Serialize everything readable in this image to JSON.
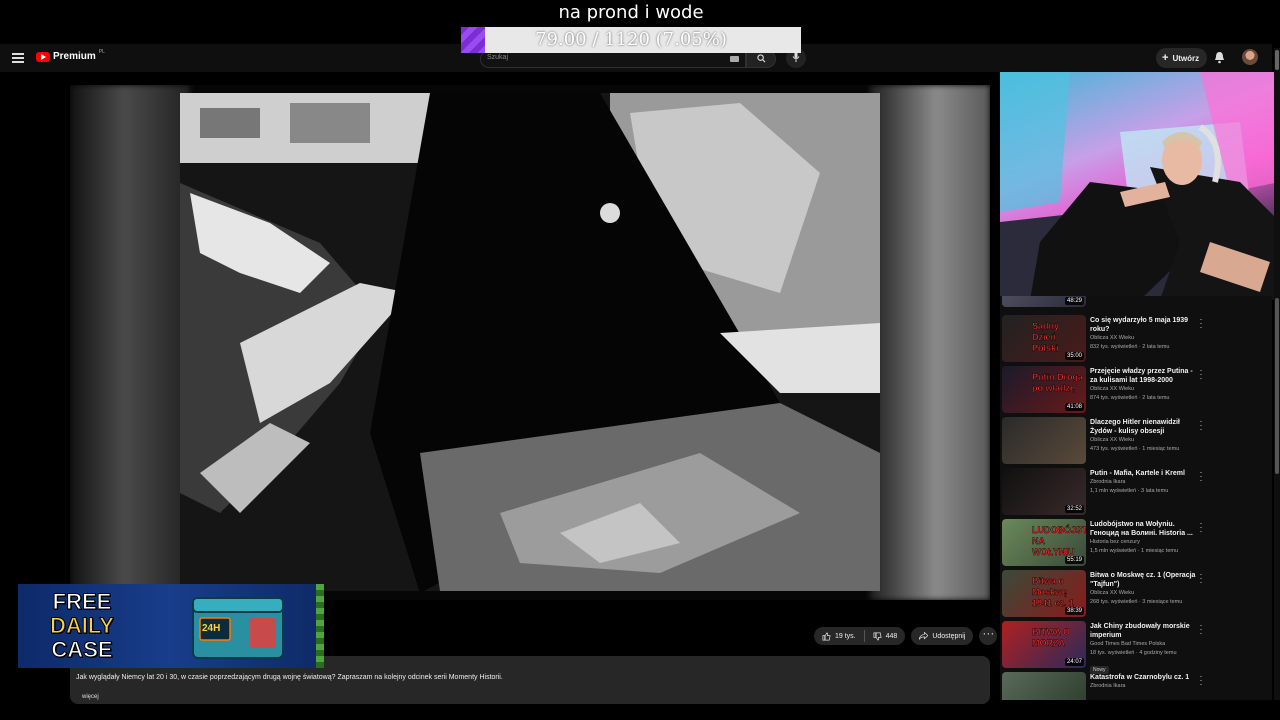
{
  "overlay": {
    "title": "na prond i wode",
    "goal_text": "79.00 / 1120 (7.05%)",
    "goal_fraction": 0.0705
  },
  "topbar": {
    "logo_text": "Premium",
    "logo_region": "PL",
    "search_placeholder": "Szukaj",
    "create_label": "Utwórz"
  },
  "video": {
    "likes": "19 tys.",
    "dislikes": "448",
    "share_label": "Udostępnij",
    "description": "Jak wyglądały Niemcy lat 20 i 30, w czasie poprzedzającym drugą wojnę światową? Zapraszam na kolejny odcinek serii Momenty Historii.",
    "more_label": "więcej"
  },
  "ad": {
    "line1": "FREE",
    "line2": "DAILY",
    "line3": "CASE",
    "badge": "24H"
  },
  "sidebar": {
    "items": [
      {
        "title": "",
        "channel": "",
        "stats": "291 tys. wyświetleń · 11 miesięcy temu",
        "duration": "48:29",
        "thumb_text": "AYRZONA SEX"
      },
      {
        "title": "Co się wydarzyło 5 maja 1939 roku?",
        "channel": "Oblicza XX Wieku",
        "stats": "832 tys. wyświetleń · 2 lata temu",
        "duration": "35:00",
        "thumb_text": "Sądny Dzień Polski"
      },
      {
        "title": "Przejęcie władzy przez Putina - za kulisami lat 1998-2000",
        "channel": "Oblicza XX Wieku",
        "stats": "874 tys. wyświetleń · 2 lata temu",
        "duration": "41:08",
        "thumb_text": "Putin Droga po władzę"
      },
      {
        "title": "Dlaczego Hitler nienawidził Żydów - kulisy obsesji",
        "channel": "Oblicza XX Wieku",
        "stats": "473 tys. wyświetleń · 1 miesiąc temu",
        "duration": "",
        "thumb_text": ""
      },
      {
        "title": "Putin - Mafia, Kartele i Kreml",
        "channel": "Zbrodnia Ikara",
        "stats": "1,1 mln wyświetleń · 3 lata temu",
        "duration": "32:52",
        "thumb_text": ""
      },
      {
        "title": "Ludobójstwo na Wołyniu. Геноцид на Волині. Historia ...",
        "channel": "Historia bez cenzury",
        "stats": "1,5 mln wyświetleń · 1 miesiąc temu",
        "duration": "55:19",
        "thumb_text": "LUDOBÓJSTWO NA WOŁYNIU"
      },
      {
        "title": "Bitwa o Moskwę cz. 1 (Operacja \"Tajfun\")",
        "channel": "Oblicza XX Wieku",
        "stats": "268 tys. wyświetleń · 3 miesiące temu",
        "duration": "38:39",
        "thumb_text": "Bitwa o Moskwę 1941 cz. 1"
      },
      {
        "title": "Jak Chiny zbudowały morskie imperium",
        "channel": "Good Times Bad Times Polska",
        "stats": "18 tys. wyświetleń · 4 godziny temu",
        "duration": "24:07",
        "thumb_text": "BITWA O MORZA",
        "badge": "Nowy"
      },
      {
        "title": "Katastrofa w Czarnobylu cz. 1",
        "channel": "Zbrodnia Ikara",
        "stats": "",
        "duration": "",
        "thumb_text": ""
      }
    ]
  },
  "colors": {
    "accent": "#ff0000",
    "goal_fill": "#8a3de6",
    "background": "#0f0f0f"
  }
}
